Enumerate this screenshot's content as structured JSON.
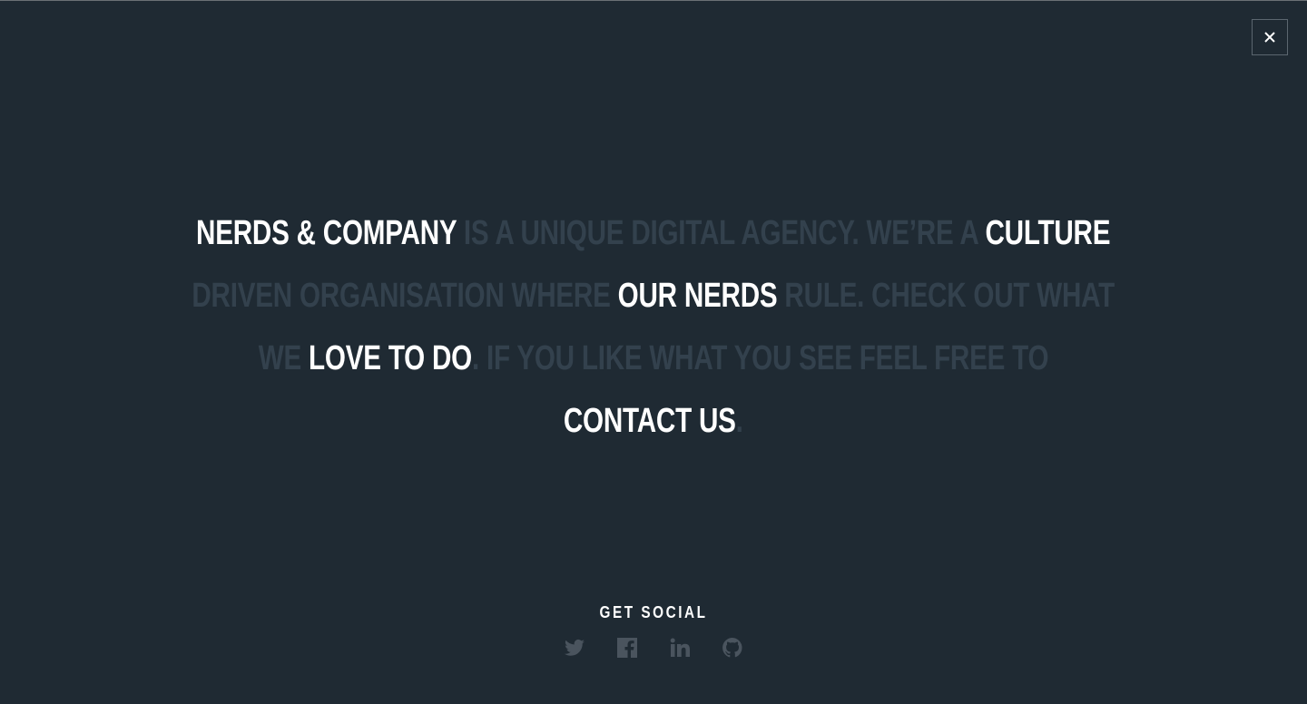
{
  "close_button": {
    "icon": "close-icon",
    "label": "×"
  },
  "statement": {
    "lines": [
      [
        {
          "text": "NERDS & COMPANY",
          "highlight": true
        },
        {
          "text": " IS A UNIQUE DIGITAL AGENCY. WE’RE A ",
          "highlight": false
        },
        {
          "text": "CULTURE",
          "highlight": true
        }
      ],
      [
        {
          "text": "DRIVEN ORGANISATION WHERE ",
          "highlight": false
        },
        {
          "text": "OUR NERDS",
          "highlight": true
        },
        {
          "text": " RULE. CHECK OUT WHAT",
          "highlight": false
        }
      ],
      [
        {
          "text": "WE ",
          "highlight": false
        },
        {
          "text": "LOVE TO DO",
          "highlight": true
        },
        {
          "text": ". IF YOU LIKE WHAT YOU SEE FEEL FREE TO",
          "highlight": false
        }
      ],
      [
        {
          "text": "CONTACT US",
          "highlight": true
        },
        {
          "text": ".",
          "highlight": false
        }
      ]
    ]
  },
  "social": {
    "title": "GET SOCIAL",
    "icons": [
      "twitter-icon",
      "facebook-icon",
      "linkedin-icon",
      "github-icon"
    ]
  },
  "colors": {
    "background": "#1f2a33",
    "muted_text": "#33414d",
    "highlight_text": "#ffffff",
    "icon": "#4a545e"
  }
}
